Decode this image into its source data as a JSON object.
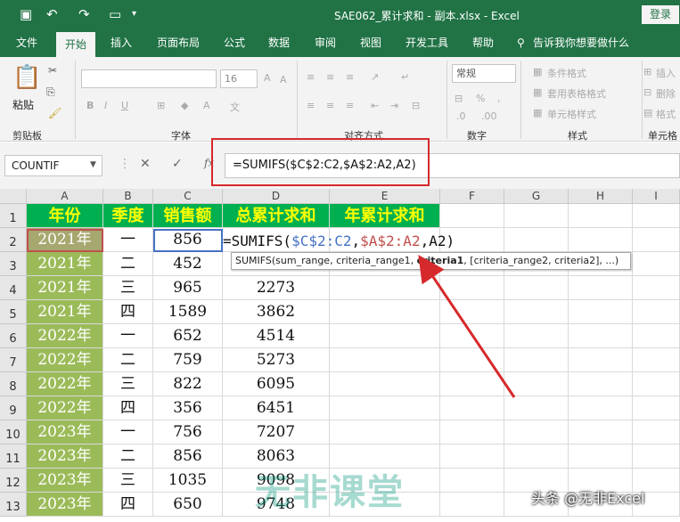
{
  "window": {
    "title": "SAE062_累计求和 - 副本.xlsx  -  Excel",
    "login_label": "登录"
  },
  "tabs": [
    "文件",
    "开始",
    "插入",
    "页面布局",
    "公式",
    "数据",
    "审阅",
    "视图",
    "开发工具",
    "帮助"
  ],
  "active_tab": "开始",
  "tell_me": "告诉我你想要做什么",
  "ribbon": {
    "clipboard": {
      "paste_label": "粘贴",
      "group_label": "剪贴板"
    },
    "font": {
      "font_size": "16",
      "group_label": "字体"
    },
    "alignment": {
      "group_label": "对齐方式"
    },
    "number": {
      "format": "常规",
      "group_label": "数字"
    },
    "styles": {
      "items": [
        "条件格式",
        "套用表格格式",
        "单元格样式"
      ],
      "group_label": "样式"
    },
    "cells": {
      "items": [
        "插入",
        "删除",
        "格式"
      ],
      "group_label": "单元格"
    }
  },
  "formula_bar": {
    "name_box": "COUNTIF",
    "fx_label": "fx",
    "formula": "=SUMIFS($C$2:C2,$A$2:A2,A2)"
  },
  "columns": [
    "A",
    "B",
    "C",
    "D",
    "E",
    "F",
    "G",
    "H",
    "I"
  ],
  "headers": [
    "年份",
    "季度",
    "销售额",
    "总累计求和",
    "年累计求和"
  ],
  "rows": [
    {
      "num": "1"
    },
    {
      "num": "2",
      "year": "2021年",
      "quarter": "一",
      "sales": "856",
      "total": ""
    },
    {
      "num": "3",
      "year": "2021年",
      "quarter": "二",
      "sales": "452",
      "total": ""
    },
    {
      "num": "4",
      "year": "2021年",
      "quarter": "三",
      "sales": "965",
      "total": "2273"
    },
    {
      "num": "5",
      "year": "2021年",
      "quarter": "四",
      "sales": "1589",
      "total": "3862"
    },
    {
      "num": "6",
      "year": "2022年",
      "quarter": "一",
      "sales": "652",
      "total": "4514"
    },
    {
      "num": "7",
      "year": "2022年",
      "quarter": "二",
      "sales": "759",
      "total": "5273"
    },
    {
      "num": "8",
      "year": "2022年",
      "quarter": "三",
      "sales": "822",
      "total": "6095"
    },
    {
      "num": "9",
      "year": "2022年",
      "quarter": "四",
      "sales": "356",
      "total": "6451"
    },
    {
      "num": "10",
      "year": "2023年",
      "quarter": "一",
      "sales": "756",
      "total": "7207"
    },
    {
      "num": "11",
      "year": "2023年",
      "quarter": "二",
      "sales": "856",
      "total": "8063"
    },
    {
      "num": "12",
      "year": "2023年",
      "quarter": "三",
      "sales": "1035",
      "total": "9098"
    },
    {
      "num": "13",
      "year": "2023年",
      "quarter": "四",
      "sales": "650",
      "total": "9748"
    }
  ],
  "edit": {
    "prefix": "=SUMIFS(",
    "ref1": "$C$2:C2",
    "comma1": ",",
    "ref2": "$A$2:A2",
    "rest": ",A2)"
  },
  "tooltip": {
    "part1": "SUMIFS(sum_range, criteria_range1, ",
    "bold": "criteria1",
    "part2": ", [criteria_range2, criteria2], ...)"
  },
  "watermark": "无非课堂",
  "credit": "头条 @无非Excel",
  "colors": {
    "excel_green": "#217346",
    "header_fill": "#00b050",
    "header_text": "#ffff00",
    "year_fill": "#9bbb59",
    "annotation_red": "#d6292c"
  }
}
